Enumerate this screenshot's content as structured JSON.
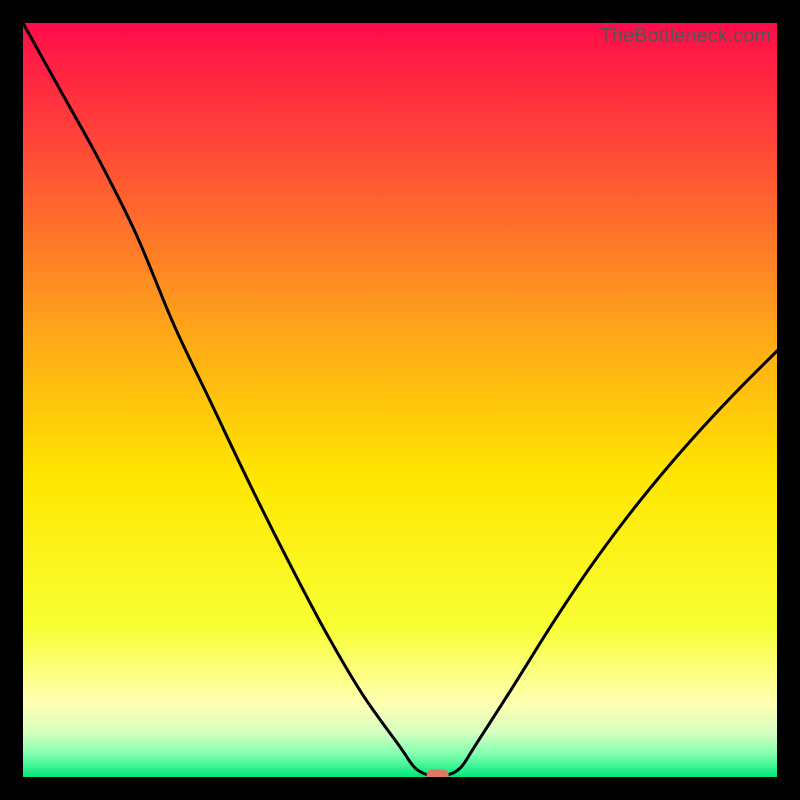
{
  "watermark": "TheBottleneck.com",
  "chart_data": {
    "type": "line",
    "title": "",
    "xlabel": "",
    "ylabel": "",
    "xlim": [
      0,
      100
    ],
    "ylim": [
      0,
      100
    ],
    "x": [
      0,
      5,
      10,
      15,
      20,
      25,
      30,
      35,
      40,
      45,
      50,
      52,
      54,
      56,
      58,
      60,
      65,
      70,
      75,
      80,
      85,
      90,
      95,
      100
    ],
    "values": [
      100,
      91,
      82,
      72,
      60,
      49.5,
      39,
      29,
      19.5,
      11,
      4,
      1.2,
      0.2,
      0.2,
      1.2,
      4.2,
      12,
      20,
      27.5,
      34.3,
      40.5,
      46.2,
      51.5,
      56.5
    ],
    "marker": {
      "x": 55,
      "y": 0.2
    },
    "gradient_stops": [
      {
        "offset": 0.0,
        "color": "#ff0c4a"
      },
      {
        "offset": 0.2,
        "color": "#ff5533"
      },
      {
        "offset": 0.4,
        "color": "#ffa31a"
      },
      {
        "offset": 0.6,
        "color": "#ffe600"
      },
      {
        "offset": 0.8,
        "color": "#f8ff33"
      },
      {
        "offset": 0.9,
        "color": "#ffffb0"
      },
      {
        "offset": 0.94,
        "color": "#d8ffc0"
      },
      {
        "offset": 0.97,
        "color": "#80ffb0"
      },
      {
        "offset": 1.0,
        "color": "#00e878"
      }
    ],
    "marker_color": "#e07868"
  }
}
